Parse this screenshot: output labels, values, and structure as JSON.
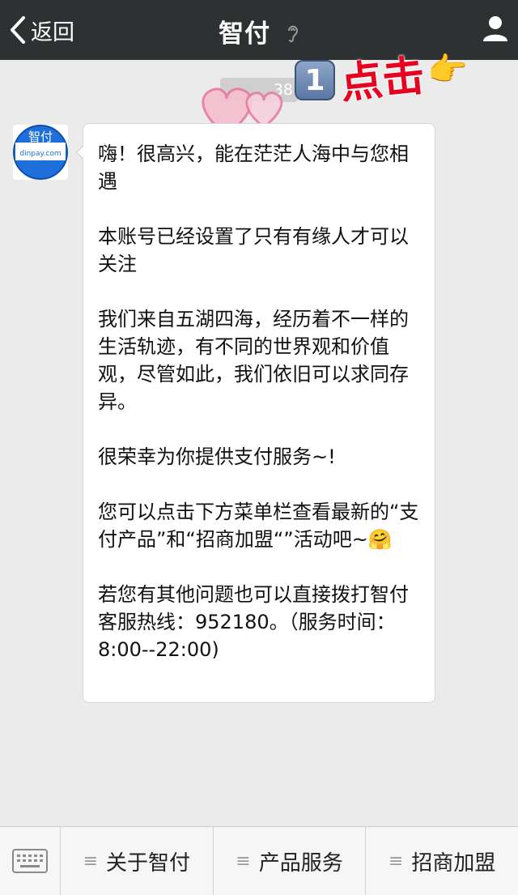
{
  "navbar": {
    "back_label": "返回",
    "title": "智付"
  },
  "chat": {
    "timestamp": "38",
    "avatar_text": "智付",
    "avatar_subtext": "dinpay.com",
    "message": [
      "嗨！很高兴，能在茫茫人海中与您相遇",
      "本账号已经设置了只有有缘人才可以关注",
      "我们来自五湖四海，经历着不一样的生活轨迹，有不同的世界观和价值观，尽管如此，我们依旧可以求同存异。",
      "很荣幸为你提供支付服务~!",
      "您可以点击下方菜单栏查看最新的“支付产品”和“招商加盟“”活动吧~🤗",
      "若您有其他问题也可以直接拨打智付客服热线：952180。（服务时间： 8:00--22:00)"
    ]
  },
  "annotation": {
    "badge": "1",
    "text": "点击",
    "hand": "👉"
  },
  "menu": {
    "items": [
      {
        "label": "关于智付"
      },
      {
        "label": "产品服务"
      },
      {
        "label": "招商加盟"
      }
    ]
  },
  "colors": {
    "navbar_bg": "#2e3132",
    "chat_bg": "#ebebeb",
    "annotation_red": "#e8001f",
    "avatar_blue": "#1e6fd9"
  },
  "icons": {
    "back": "chevron-left-icon",
    "ear": "ear-icon",
    "profile": "user-icon",
    "keyboard": "keyboard-icon",
    "menu": "menu-lines-icon"
  }
}
